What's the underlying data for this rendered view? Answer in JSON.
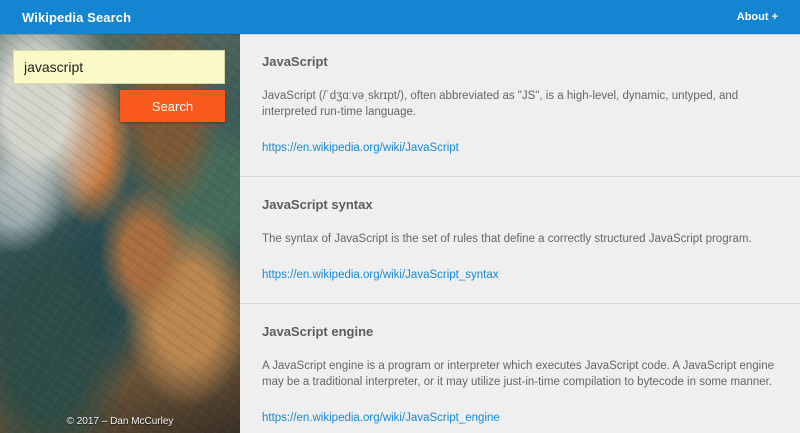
{
  "header": {
    "title": "Wikipedia Search",
    "about_label": "About +"
  },
  "sidebar": {
    "search_value": "javascript",
    "search_button_label": "Search",
    "credit": "© 2017 – Dan McCurley"
  },
  "results": [
    {
      "title": "JavaScript",
      "snippet": "JavaScript (/ˈdʒɑːvəˌskrɪpt/), often abbreviated as \"JS\", is a high-level, dynamic, untyped, and interpreted run-time language.",
      "url": "https://en.wikipedia.org/wiki/JavaScript"
    },
    {
      "title": "JavaScript syntax",
      "snippet": "The syntax of JavaScript is the set of rules that define a correctly structured JavaScript program.",
      "url": "https://en.wikipedia.org/wiki/JavaScript_syntax"
    },
    {
      "title": "JavaScript engine",
      "snippet": "A JavaScript engine is a program or interpreter which executes JavaScript code. A JavaScript engine may be a traditional interpreter, or it may utilize just-in-time compilation to bytecode in some manner.",
      "url": "https://en.wikipedia.org/wiki/JavaScript_engine"
    }
  ],
  "colors": {
    "header": "#1485d0",
    "search_button": "#f85a1e",
    "search_input": "#fafac8",
    "link": "#1589d6"
  }
}
